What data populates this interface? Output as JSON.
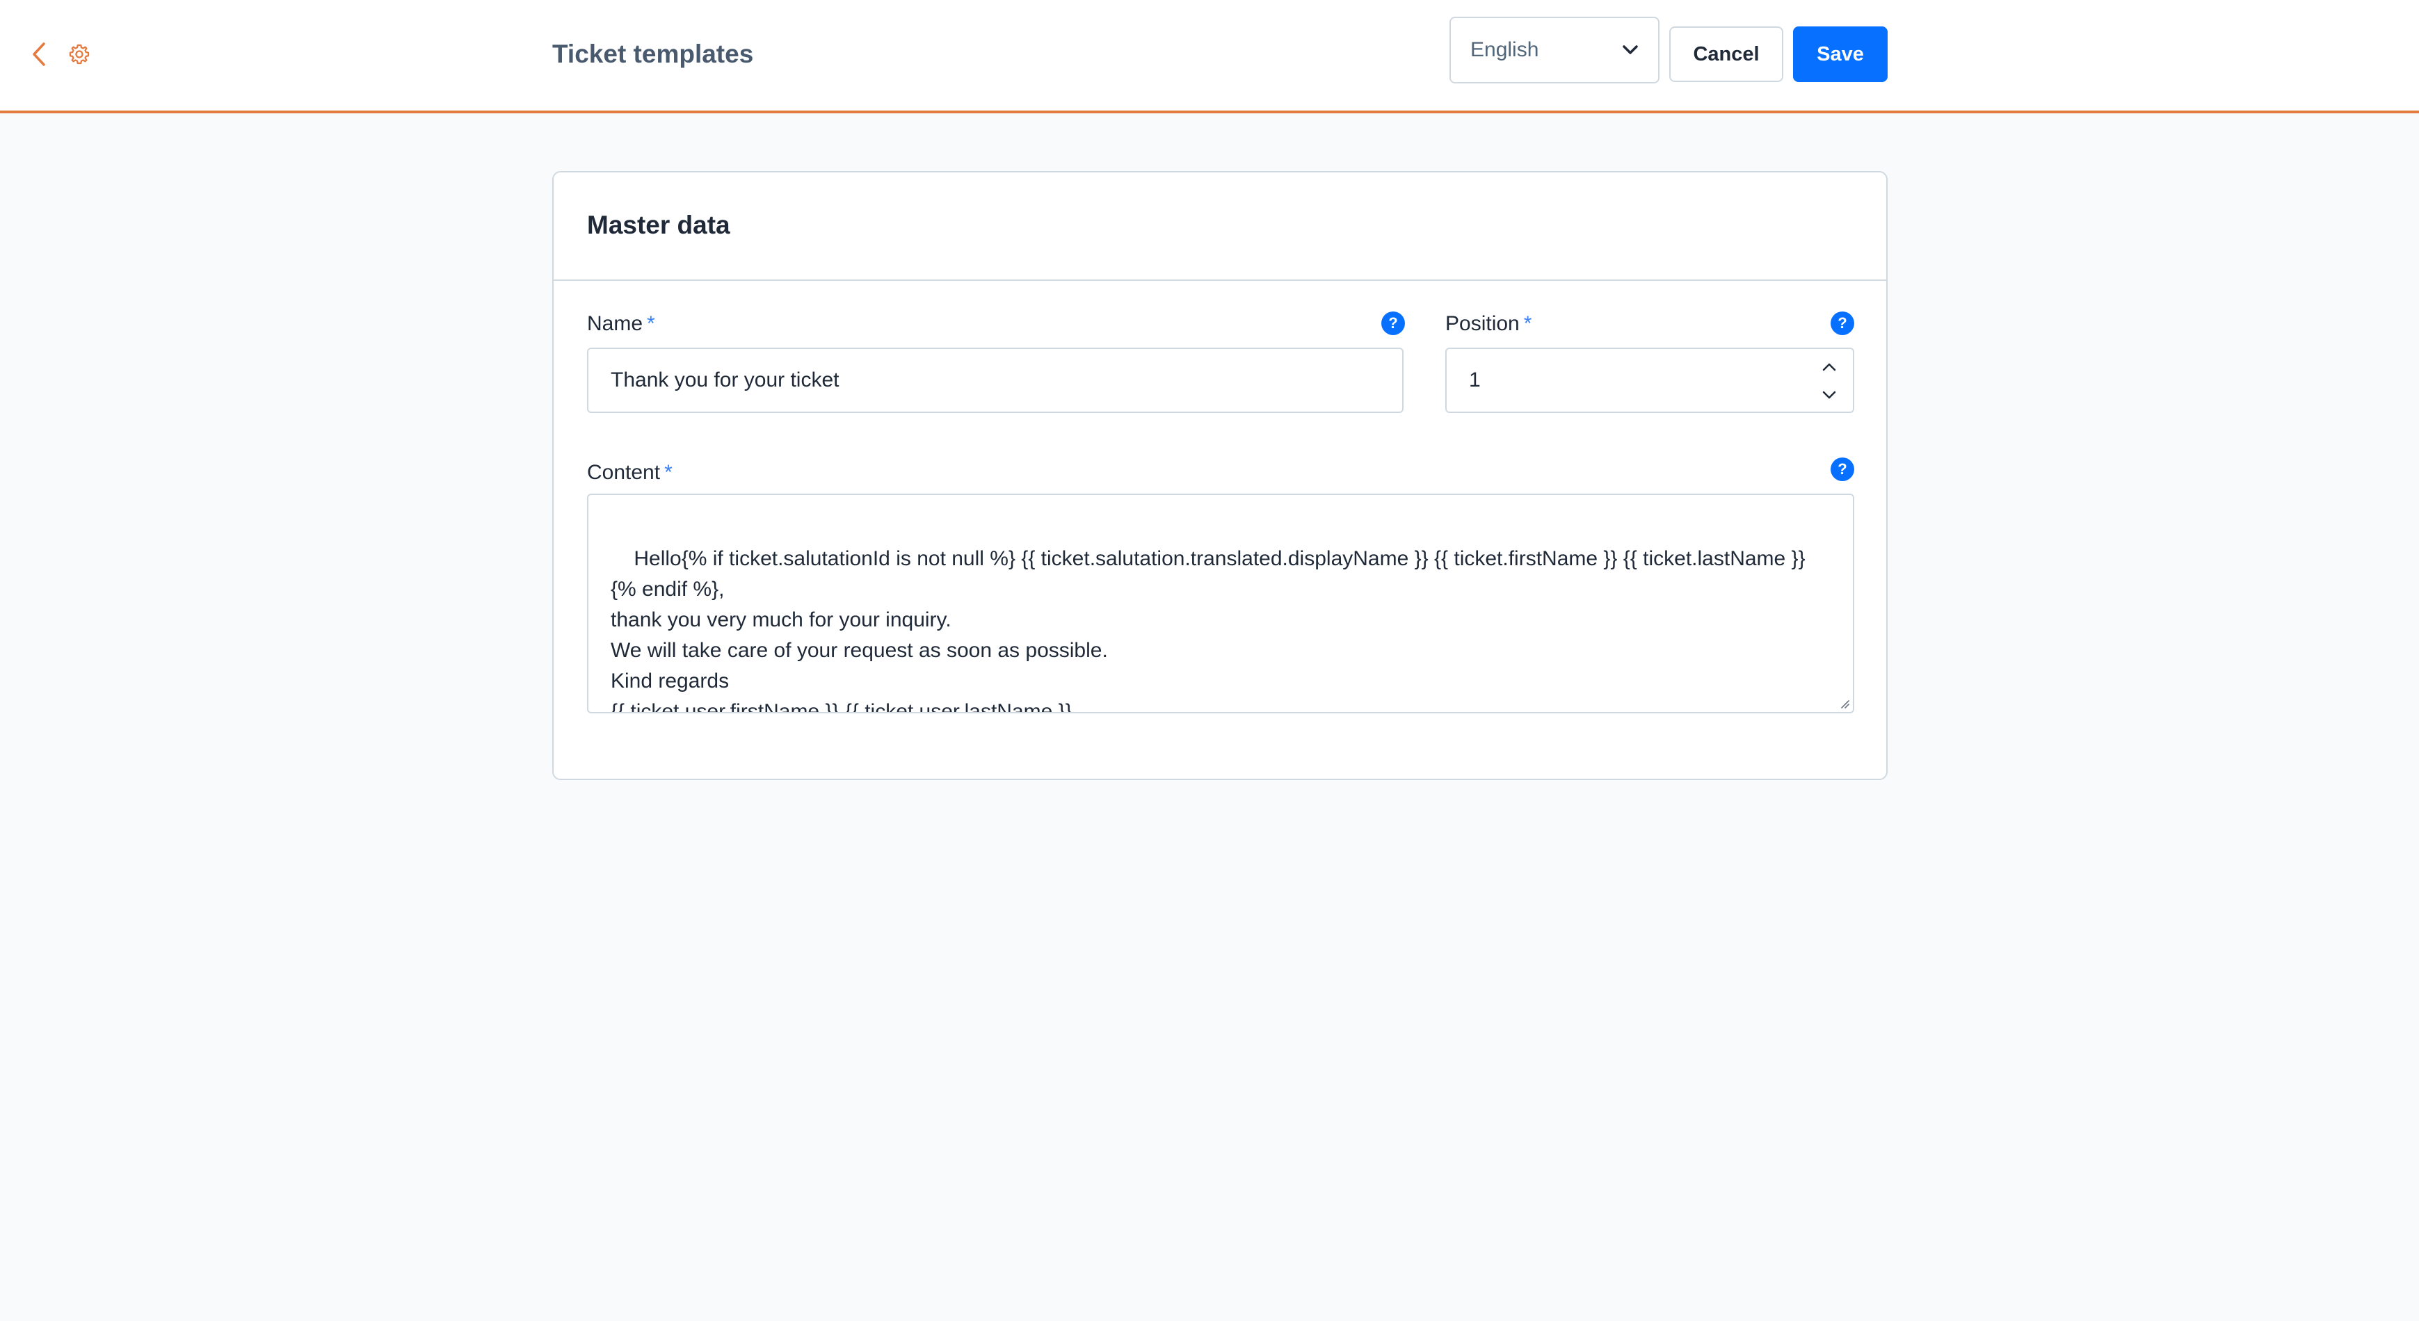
{
  "header": {
    "title": "Ticket templates",
    "back_icon": "chevron-left-icon",
    "module_icon": "gear-icon",
    "language": "English",
    "cancel_label": "Cancel",
    "save_label": "Save"
  },
  "colors": {
    "accent": "#e57a3e",
    "primary": "#0870ff",
    "border": "#d1d9e0"
  },
  "card": {
    "title": "Master data",
    "name": {
      "label": "Name",
      "required_mark": "*",
      "value": "Thank you for your ticket",
      "help": "?"
    },
    "position": {
      "label": "Position",
      "required_mark": "*",
      "value": "1",
      "help": "?"
    },
    "content": {
      "label": "Content",
      "required_mark": "*",
      "value": "Hello{% if ticket.salutationId is not null %} {{ ticket.salutation.translated.displayName }} {{ ticket.firstName }} {{ ticket.lastName }}{% endif %},\nthank you very much for your inquiry.\nWe will take care of your request as soon as possible.\nKind regards\n{{ ticket.user.firstName }} {{ ticket.user.lastName }}",
      "help": "?"
    }
  }
}
